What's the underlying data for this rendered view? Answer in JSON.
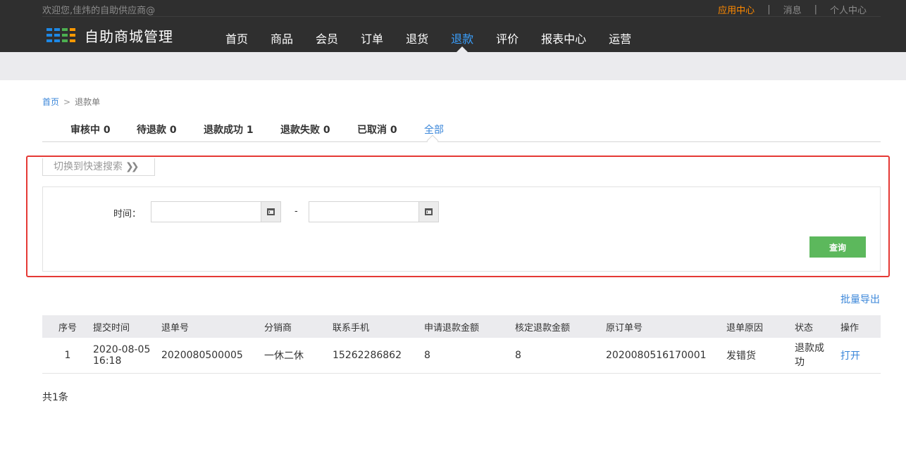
{
  "header": {
    "welcome": "欢迎您,佳炜的自助供应商@",
    "app_center": "应用中心",
    "messages": "消息",
    "personal_center": "个人中心",
    "separator": "|",
    "logo_text": "自助商城管理"
  },
  "nav": {
    "items": [
      "首页",
      "商品",
      "会员",
      "订单",
      "退货",
      "退款",
      "评价",
      "报表中心",
      "运营"
    ],
    "active": "退款"
  },
  "breadcrumb": {
    "home": "首页",
    "arrow": ">",
    "current": "退款单"
  },
  "tabs": [
    {
      "label": "审核中 0"
    },
    {
      "label": "待退款 0"
    },
    {
      "label": "退款成功 1"
    },
    {
      "label": "退款失败 0"
    },
    {
      "label": "已取消 0"
    },
    {
      "label": "全部"
    }
  ],
  "search": {
    "quick_switch": "切换到快速搜索",
    "time_label": "时间：",
    "start_date": "",
    "end_date": "",
    "range_separator": "-",
    "query_button": "查询"
  },
  "batch_export": "批量导出",
  "table": {
    "columns": [
      "序号",
      "提交时间",
      "退单号",
      "分销商",
      "联系手机",
      "申请退款金额",
      "核定退款金额",
      "原订单号",
      "退单原因",
      "状态",
      "操作"
    ],
    "rows": [
      {
        "index": "1",
        "submit_date": "2020-08-05",
        "submit_time": "16:18",
        "refund_no": "2020080500005",
        "distributor": "一休二休",
        "phone": "15262286862",
        "requested_amount": "8",
        "approved_amount": "8",
        "order_no": "2020080516170001",
        "reason": "发错货",
        "status": "退款成功",
        "action": "打开"
      }
    ]
  },
  "total": "共1条",
  "colors": {
    "accent": "#3a86d9",
    "orange": "#ff8a00",
    "green_button": "#5cb85c",
    "highlight_frame": "#e53935",
    "header_bg": "#2f2f2f"
  }
}
